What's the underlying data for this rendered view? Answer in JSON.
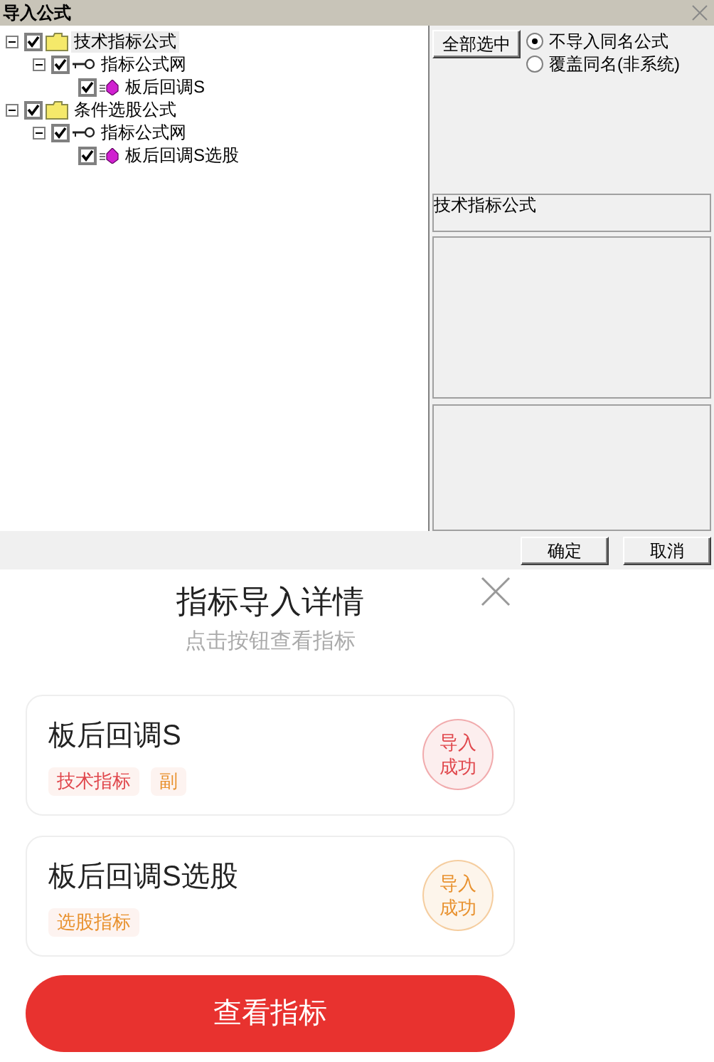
{
  "window": {
    "title": "导入公式"
  },
  "tree": [
    {
      "label": "技术指标公式",
      "kind": "folder",
      "checked": true,
      "expanded": true,
      "selected": true,
      "children": [
        {
          "label": "指标公式网",
          "kind": "group",
          "checked": true,
          "expanded": true,
          "selected": false,
          "children": [
            {
              "label": "板后回调S",
              "kind": "formula",
              "checked": true,
              "selected": false
            }
          ]
        }
      ]
    },
    {
      "label": "条件选股公式",
      "kind": "folder",
      "checked": true,
      "expanded": true,
      "selected": false,
      "children": [
        {
          "label": "指标公式网",
          "kind": "group",
          "checked": true,
          "expanded": true,
          "selected": false,
          "children": [
            {
              "label": "板后回调S选股",
              "kind": "formula",
              "checked": true,
              "selected": false
            }
          ]
        }
      ]
    }
  ],
  "select_all_button": "全部选中",
  "options": [
    {
      "label": "不导入同名公式",
      "selected": true
    },
    {
      "label": "覆盖同名(非系统)",
      "selected": false
    }
  ],
  "category_field": {
    "value": "技术指标公式"
  },
  "dialog_buttons": [
    "确定",
    "取消"
  ],
  "result_panel": {
    "title": "指标导入详情",
    "subtitle": "点击按钮查看指标",
    "items": [
      {
        "name": "板后回调S",
        "tags": [
          {
            "label": "技术指标",
            "color": "#e0474c"
          },
          {
            "label": "副",
            "color": "#e8912e"
          }
        ],
        "status": "导入成功",
        "color": "#e0474c"
      },
      {
        "name": "板后回调S选股",
        "tags": [
          {
            "label": "选股指标",
            "color": "#e8912e"
          }
        ],
        "status": "导入成功",
        "color": "#e8912e"
      }
    ],
    "button": "查看指标"
  }
}
